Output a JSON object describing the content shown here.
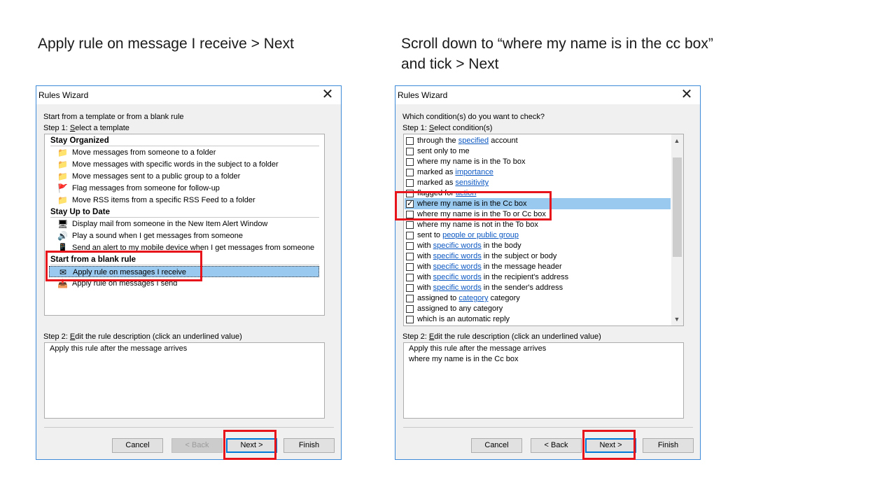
{
  "captions": {
    "left": "Apply rule on message I receive > Next",
    "right_line1": "Scroll down to “where my name is in the cc box”",
    "right_line2": "and tick > Next"
  },
  "left_dialog": {
    "title": "Rules Wizard",
    "intro": "Start from a template or from a blank rule",
    "step1": "Step 1: Select a template",
    "groups": [
      {
        "header": "Stay Organized",
        "items": [
          {
            "label": "Move messages from someone to a folder",
            "icon": "envelope-folder-icon"
          },
          {
            "label": "Move messages with specific words in the subject to a folder",
            "icon": "envelope-folder-icon"
          },
          {
            "label": "Move messages sent to a public group to a folder",
            "icon": "envelope-folder-icon"
          },
          {
            "label": "Flag messages from someone for follow-up",
            "icon": "red-flag-icon"
          },
          {
            "label": "Move RSS items from a specific RSS Feed to a folder",
            "icon": "envelope-folder-icon"
          }
        ]
      },
      {
        "header": "Stay Up to Date",
        "items": [
          {
            "label": "Display mail from someone in the New Item Alert Window",
            "icon": "alert-window-icon"
          },
          {
            "label": "Play a sound when I get messages from someone",
            "icon": "speaker-icon"
          },
          {
            "label": "Send an alert to my mobile device when I get messages from someone",
            "icon": "mobile-device-icon"
          }
        ]
      },
      {
        "header": "Start from a blank rule",
        "items": [
          {
            "label": "Apply rule on messages I receive",
            "icon": "envelope-icon",
            "selected": true
          },
          {
            "label": "Apply rule on messages I send",
            "icon": "outgoing-message-icon"
          }
        ]
      }
    ],
    "step2": "Step 2: Edit the rule description (click an underlined value)",
    "description": [
      "Apply this rule after the message arrives"
    ],
    "buttons": {
      "cancel": "Cancel",
      "back": "< Back",
      "next": "Next >",
      "finish": "Finish"
    }
  },
  "right_dialog": {
    "title": "Rules Wizard",
    "intro": "Which condition(s) do you want to check?",
    "step1": "Step 1: Select condition(s)",
    "conditions": [
      {
        "pre": "through the ",
        "link": "specified",
        "post": " account",
        "checked": false
      },
      {
        "pre": "sent only to me",
        "link": "",
        "post": "",
        "checked": false
      },
      {
        "pre": "where my name is in the To box",
        "link": "",
        "post": "",
        "checked": false
      },
      {
        "pre": "marked as ",
        "link": "importance",
        "post": "",
        "checked": false
      },
      {
        "pre": "marked as ",
        "link": "sensitivity",
        "post": "",
        "checked": false
      },
      {
        "pre": "flagged for ",
        "link": "action",
        "post": "",
        "checked": false
      },
      {
        "pre": "where my name is in the Cc box",
        "link": "",
        "post": "",
        "checked": true,
        "selected": true
      },
      {
        "pre": "where my name is in the To or Cc box",
        "link": "",
        "post": "",
        "checked": false
      },
      {
        "pre": "where my name is not in the To box",
        "link": "",
        "post": "",
        "checked": false
      },
      {
        "pre": "sent to ",
        "link": "people or public group",
        "post": "",
        "checked": false
      },
      {
        "pre": "with ",
        "link": "specific words",
        "post": " in the body",
        "checked": false
      },
      {
        "pre": "with ",
        "link": "specific words",
        "post": " in the subject or body",
        "checked": false
      },
      {
        "pre": "with ",
        "link": "specific words",
        "post": " in the message header",
        "checked": false
      },
      {
        "pre": "with ",
        "link": "specific words",
        "post": " in the recipient's address",
        "checked": false
      },
      {
        "pre": "with ",
        "link": "specific words",
        "post": " in the sender's address",
        "checked": false
      },
      {
        "pre": "assigned to ",
        "link": "category",
        "post": " category",
        "checked": false
      },
      {
        "pre": "assigned to any category",
        "link": "",
        "post": "",
        "checked": false
      },
      {
        "pre": "which is an automatic reply",
        "link": "",
        "post": "",
        "checked": false
      }
    ],
    "step2": "Step 2: Edit the rule description (click an underlined value)",
    "description": [
      "Apply this rule after the message arrives",
      "where my name is in the Cc box"
    ],
    "buttons": {
      "cancel": "Cancel",
      "back": "< Back",
      "next": "Next >",
      "finish": "Finish"
    }
  },
  "colors": {
    "highlight": "#e8141b",
    "selection": "#99c9ef",
    "link": "#0b57c2",
    "dialog_border": "#3c8ad8"
  }
}
